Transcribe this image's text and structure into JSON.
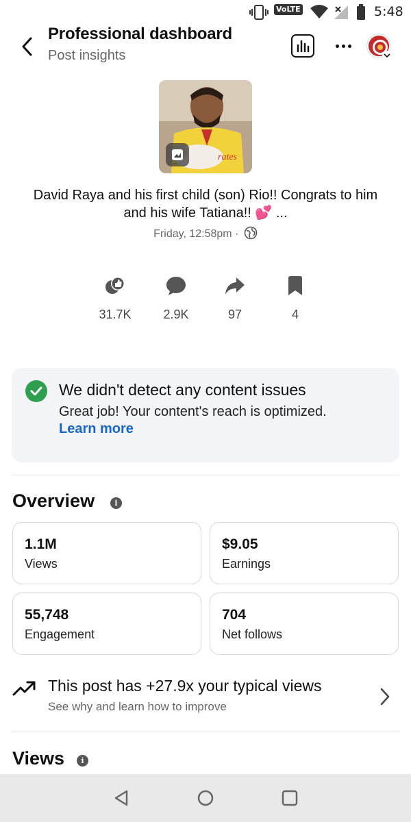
{
  "status_bar": {
    "network_badge": "VoLTE",
    "time": "5:48"
  },
  "header": {
    "title": "Professional dashboard",
    "subtitle": "Post insights",
    "icons": [
      "back-icon",
      "bar-chart-icon",
      "more-icon",
      "avatar",
      "chevron-down-icon"
    ]
  },
  "post": {
    "caption": "David Raya and his first child (son) Rio!! Congrats to him and his wife Tatiana!! 💕 ...",
    "timestamp": "Friday, 12:58pm ·",
    "stats": [
      {
        "icon": "reactions-icon",
        "value": "31.7K"
      },
      {
        "icon": "comment-icon",
        "value": "2.9K"
      },
      {
        "icon": "share-icon",
        "value": "97"
      },
      {
        "icon": "bookmark-icon",
        "value": "4"
      }
    ]
  },
  "content_check": {
    "title": "We didn't detect any content issues",
    "body": "Great job! Your content's reach is optimized.",
    "link": "Learn more"
  },
  "overview": {
    "title": "Overview",
    "metrics": [
      {
        "value": "1.1M",
        "label": "Views"
      },
      {
        "value": "$9.05",
        "label": "Earnings"
      },
      {
        "value": "55,748",
        "label": "Engagement"
      },
      {
        "value": "704",
        "label": "Net follows"
      }
    ]
  },
  "insight": {
    "title": "This post has +27.9x your typical views",
    "subtitle": "See why and learn how to improve"
  },
  "views_section": {
    "title": "Views"
  },
  "colors": {
    "accent_link": "#1766c7",
    "success_green": "#2e9e4f",
    "card_bg": "#f2f4f7",
    "nav_bg": "#e9e9e9"
  }
}
